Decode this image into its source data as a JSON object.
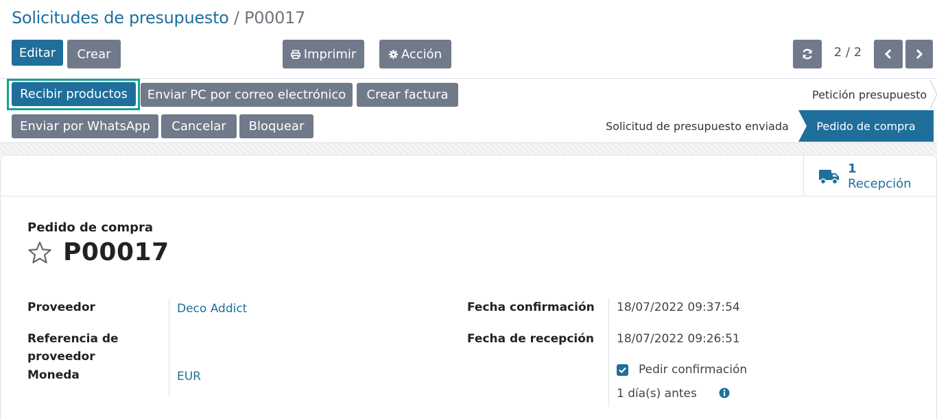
{
  "breadcrumb": {
    "parent": "Solicitudes de presupuesto",
    "separator": "/",
    "current": "P00017"
  },
  "toolbar": {
    "edit": "Editar",
    "create": "Crear",
    "print": "Imprimir",
    "action": "Acción"
  },
  "pager": {
    "value": "2 / 2"
  },
  "header_buttons": {
    "receive": "Recibir productos",
    "email_po": "Enviar PC por correo electrónico",
    "create_bill": "Crear factura",
    "whatsapp": "Enviar por WhatsApp",
    "cancel": "Cancelar",
    "lock": "Bloquear"
  },
  "statusbar": {
    "stages": [
      "Petición presupuesto",
      "Solicitud de presupuesto enviada",
      "Pedido de compra"
    ],
    "active": "Pedido de compra"
  },
  "smart_button": {
    "count": "1",
    "label": "Recepción"
  },
  "form": {
    "title_label": "Pedido de compra",
    "name": "P00017",
    "vendor_label": "Proveedor",
    "vendor": "Deco Addict",
    "vendor_ref_label": "Referencia de proveedor",
    "currency_label": "Moneda",
    "currency": "EUR",
    "date_approve_label": "Fecha confirmación",
    "date_approve": "18/07/2022 09:37:54",
    "date_planned_label": "Fecha de recepción",
    "date_planned": "18/07/2022 09:26:51",
    "ask_confirmation_label": "Pedir confirmación",
    "ask_confirmation_checked": true,
    "days_before": "1 día(s) antes"
  },
  "icons": {
    "print": "print-icon",
    "action": "gear-icon",
    "reload": "refresh-icon",
    "prev": "chevron-left-icon",
    "next": "chevron-right-icon",
    "truck": "truck-icon",
    "star": "star-icon",
    "info": "info-icon"
  },
  "colors": {
    "primary": "#1f6e9c",
    "secondary": "#717a8a",
    "highlight": "#12a394"
  }
}
